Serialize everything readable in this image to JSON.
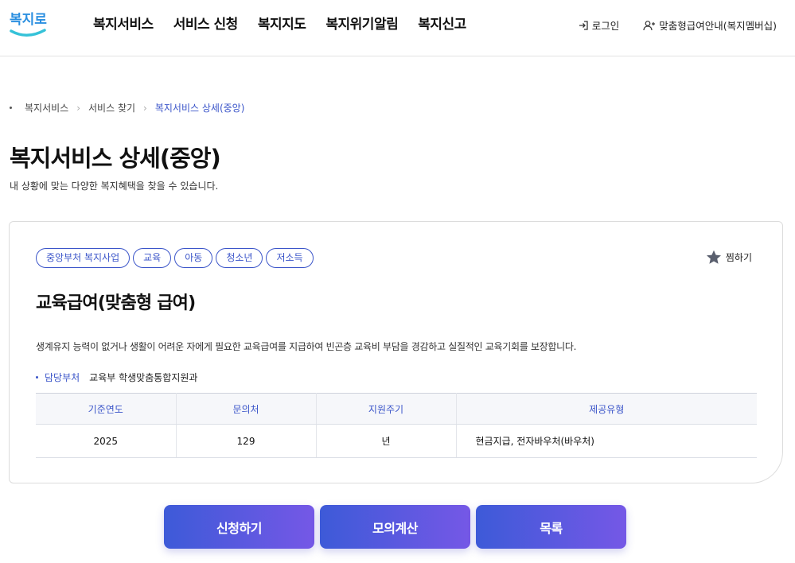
{
  "logo": {
    "text": "복지로"
  },
  "gnb": [
    {
      "label": "복지서비스"
    },
    {
      "label": "서비스 신청"
    },
    {
      "label": "복지지도"
    },
    {
      "label": "복지위기알림"
    },
    {
      "label": "복지신고"
    }
  ],
  "util": {
    "login": "로그인",
    "member": "맞춤형급여안내(복지멤버십)"
  },
  "breadcrumb": {
    "items": [
      "복지서비스",
      "서비스 찾기"
    ],
    "current": "복지서비스 상세(중앙)"
  },
  "page": {
    "title": "복지서비스 상세(중앙)",
    "description": "내 상황에 맞는 다양한 복지혜택을 찾을 수 있습니다."
  },
  "service": {
    "tags": [
      "중앙부처 복지사업",
      "교육",
      "아동",
      "청소년",
      "저소득"
    ],
    "favorite_label": "찜하기",
    "title": "교육급여(맞춤형 급여)",
    "description": "생계유지 능력이 없거나 생활이 어려운 자에게 필요한 교육급여를 지급하여 빈곤층 교육비 부담을 경감하고 실질적인 교육기회를 보장합니다.",
    "dept_label": "담당부처",
    "dept_value": "교육부 학생맞춤통합지원과",
    "table": {
      "headers": [
        "기준연도",
        "문의처",
        "지원주기",
        "제공유형"
      ],
      "row": [
        "2025",
        "129",
        "년",
        "현금지급, 전자바우처(바우처)"
      ]
    }
  },
  "buttons": {
    "apply": "신청하기",
    "simulate": "모의계산",
    "list": "목록"
  },
  "colors": {
    "accent": "#3b55c9",
    "button_gradient_start": "#3d5ad8",
    "button_gradient_end": "#7558e6",
    "logo_blue": "#2b8fe0"
  }
}
